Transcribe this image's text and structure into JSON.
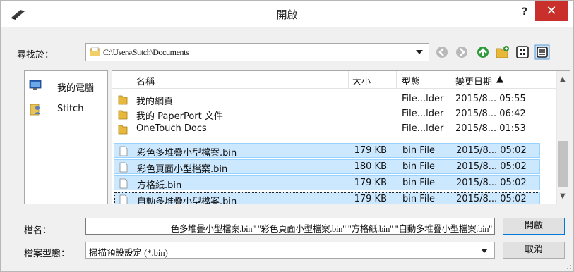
{
  "window": {
    "title": "開啟",
    "help_label": "?",
    "close_label": "✕"
  },
  "lookin": {
    "label": "尋找於：",
    "path": "C:\\Users\\Stitch\\Documents"
  },
  "toolbar": {
    "icons": [
      "back-icon",
      "forward-icon",
      "up-folder-icon",
      "new-folder-icon",
      "view-menu-icon",
      "details-view-icon"
    ]
  },
  "places": [
    {
      "label": "我的電腦",
      "icon": "computer-icon"
    },
    {
      "label": "Stitch",
      "icon": "user-folder-icon"
    }
  ],
  "columns": {
    "name": "名稱",
    "size": "大小",
    "type": "型態",
    "date": "變更日期"
  },
  "files": [
    {
      "name": "我的網頁",
      "size": "",
      "type": "File...lder",
      "date": "2015/8... 05:55",
      "kind": "folder",
      "selected": false
    },
    {
      "name": "我的 PaperPort 文件",
      "size": "",
      "type": "File...lder",
      "date": "2015/8... 06:42",
      "kind": "folder",
      "selected": false
    },
    {
      "name": "OneTouch Docs",
      "size": "",
      "type": "File...lder",
      "date": "2015/8... 01:53",
      "kind": "folder",
      "selected": false
    },
    {
      "name": "彩色多堆疊小型檔案.bin",
      "size": "179 KB",
      "type": "bin File",
      "date": "2015/8... 05:02",
      "kind": "file",
      "selected": true
    },
    {
      "name": "彩色頁面小型檔案.bin",
      "size": "180 KB",
      "type": "bin File",
      "date": "2015/8... 05:02",
      "kind": "file",
      "selected": true
    },
    {
      "name": "方格紙.bin",
      "size": "179 KB",
      "type": "bin File",
      "date": "2015/8... 05:02",
      "kind": "file",
      "selected": true
    },
    {
      "name": "自動多堆疊小型檔案.bin",
      "size": "179 KB",
      "type": "bin File",
      "date": "2015/8... 05:02",
      "kind": "file",
      "selected": true
    }
  ],
  "filename": {
    "label": "檔名：",
    "value": "色多堆疊小型檔案.bin\" \"彩色頁面小型檔案.bin\" \"方格紙.bin\" \"自動多堆疊小型檔案.bin\""
  },
  "filetype": {
    "label": "檔案型態：",
    "value": "掃描預設設定 (*.bin)"
  },
  "buttons": {
    "open": "開啟",
    "cancel": "取消"
  },
  "colors": {
    "selection": "#cce8ff",
    "selection_border": "#99d1ff",
    "close_button": "#c9302c",
    "accent": "#0078d7"
  }
}
